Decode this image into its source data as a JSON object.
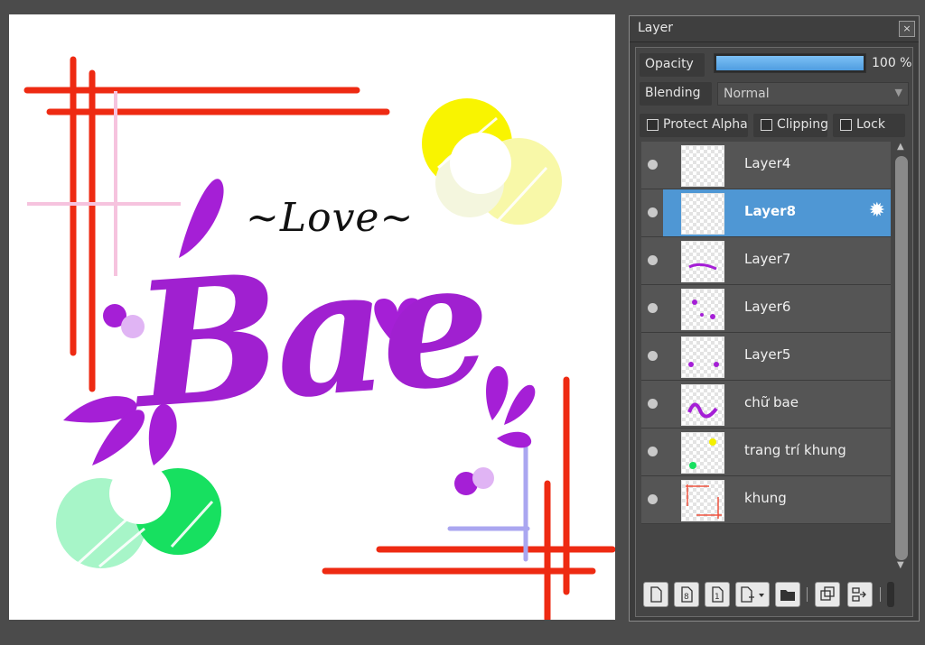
{
  "canvas": {
    "love_text": "~Love~",
    "bae_text": "Bae"
  },
  "panel": {
    "title": "Layer",
    "close_glyph": "×",
    "opacity_label": "Opacity",
    "opacity_value": "100 %",
    "opacity_fraction": 1.0,
    "blending_label": "Blending",
    "blending_value": "Normal",
    "protect_alpha_label": "Protect Alpha",
    "clipping_label": "Clipping",
    "lock_label": "Lock"
  },
  "layers": [
    {
      "name": "Layer4",
      "selected": false
    },
    {
      "name": "Layer8",
      "selected": true
    },
    {
      "name": "Layer7",
      "selected": false
    },
    {
      "name": "Layer6",
      "selected": false
    },
    {
      "name": "Layer5",
      "selected": false
    },
    {
      "name": "chữ bae",
      "selected": false
    },
    {
      "name": "trang trí khung",
      "selected": false
    },
    {
      "name": "khung",
      "selected": false
    }
  ],
  "toolbar_icons": [
    "new-layer-icon",
    "new-8bit-layer-icon",
    "new-1bit-layer-icon",
    "add-layer-menu-icon",
    "new-folder-icon",
    "duplicate-layer-icon",
    "merge-layer-icon"
  ],
  "colors": {
    "accent_blue": "#4f97d4",
    "frame_red": "#ee2a12",
    "bae_purple": "#a020d0"
  }
}
